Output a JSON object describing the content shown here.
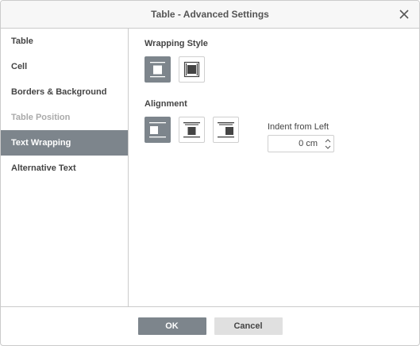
{
  "dialog": {
    "title": "Table - Advanced Settings"
  },
  "sidebar": {
    "items": [
      {
        "label": "Table",
        "state": "normal"
      },
      {
        "label": "Cell",
        "state": "normal"
      },
      {
        "label": "Borders & Background",
        "state": "normal"
      },
      {
        "label": "Table Position",
        "state": "disabled"
      },
      {
        "label": "Text Wrapping",
        "state": "active"
      },
      {
        "label": "Alternative Text",
        "state": "normal"
      }
    ]
  },
  "wrapping": {
    "label": "Wrapping Style",
    "options": [
      {
        "icon": "inline-table-icon",
        "selected": true
      },
      {
        "icon": "flow-table-icon",
        "selected": false
      }
    ]
  },
  "alignment": {
    "label": "Alignment",
    "options": [
      {
        "icon": "align-left-icon",
        "selected": true
      },
      {
        "icon": "align-center-icon",
        "selected": false
      },
      {
        "icon": "align-right-icon",
        "selected": false
      }
    ],
    "indent_label": "Indent from Left",
    "indent_value": "0 cm"
  },
  "footer": {
    "ok_label": "OK",
    "cancel_label": "Cancel"
  },
  "colors": {
    "accent": "#7d858c",
    "border": "#cbcbcb",
    "cancel_bg": "#e0e0e0"
  }
}
